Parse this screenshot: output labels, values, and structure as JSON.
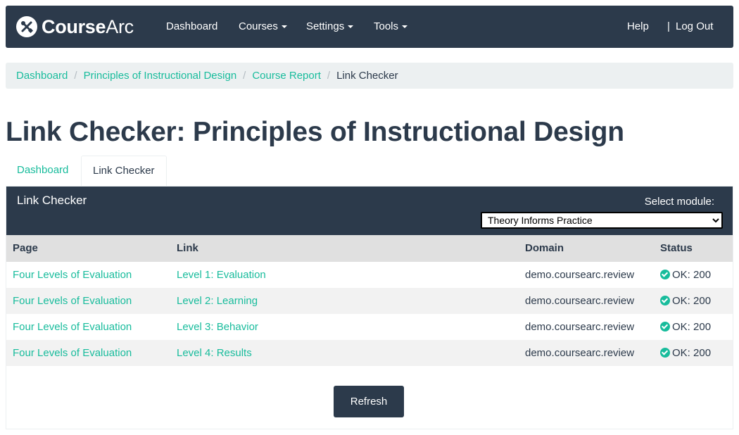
{
  "brand": {
    "name_bold": "Course",
    "name_light": "Arc",
    "icon": "tools-icon"
  },
  "nav": {
    "dashboard": "Dashboard",
    "courses": "Courses",
    "settings": "Settings",
    "tools": "Tools",
    "help": "Help",
    "separator": "|",
    "logout": "Log Out"
  },
  "breadcrumb": {
    "items": [
      "Dashboard",
      "Principles of Instructional Design",
      "Course Report"
    ],
    "active": "Link Checker",
    "separator": "/"
  },
  "page_title": "Link Checker: Principles of Instructional Design",
  "tabs": [
    {
      "label": "Dashboard",
      "active": false
    },
    {
      "label": "Link Checker",
      "active": true
    }
  ],
  "panel": {
    "title": "Link Checker",
    "module_label": "Select module:",
    "module_selected": "Theory Informs Practice"
  },
  "table": {
    "headers": [
      "Page",
      "Link",
      "Domain",
      "Status"
    ],
    "rows": [
      {
        "page": "Four Levels of Evaluation",
        "link": "Level 1: Evaluation",
        "domain": "demo.coursearc.review",
        "status": "OK: 200"
      },
      {
        "page": "Four Levels of Evaluation",
        "link": "Level 2: Learning",
        "domain": "demo.coursearc.review",
        "status": "OK: 200"
      },
      {
        "page": "Four Levels of Evaluation",
        "link": "Level 3: Behavior",
        "domain": "demo.coursearc.review",
        "status": "OK: 200"
      },
      {
        "page": "Four Levels of Evaluation",
        "link": "Level 4: Results",
        "domain": "demo.coursearc.review",
        "status": "OK: 200"
      }
    ]
  },
  "refresh_label": "Refresh",
  "colors": {
    "navy": "#2c3a4b",
    "accent": "#18bc9c",
    "light": "#ecf0f1"
  }
}
